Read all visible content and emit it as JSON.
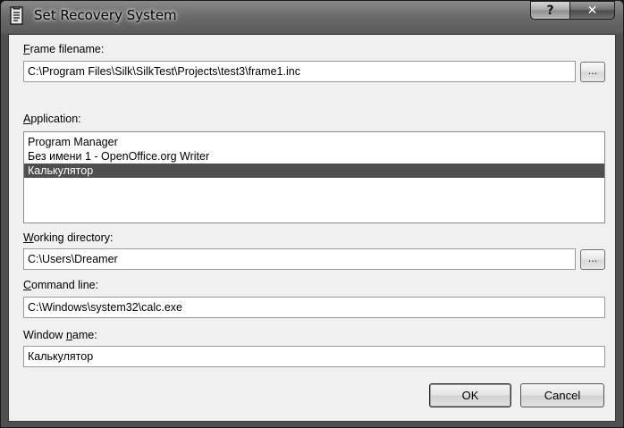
{
  "window": {
    "title": "Set Recovery System",
    "help_glyph": "?",
    "close_glyph": "✕"
  },
  "frame_filename": {
    "label_access": "F",
    "label_rest": "rame filename:",
    "value": "C:\\Program Files\\Silk\\SilkTest\\Projects\\test3\\frame1.inc",
    "browse_label": "..."
  },
  "application": {
    "label_access": "A",
    "label_rest": "pplication:",
    "items": [
      {
        "label": "Program Manager"
      },
      {
        "label": "Без имени 1 - OpenOffice.org Writer"
      },
      {
        "label": "Калькулятор"
      }
    ],
    "selected_index": 2
  },
  "working_directory": {
    "label_access": "W",
    "label_rest": "orking directory:",
    "value": "C:\\Users\\Dreamer",
    "browse_label": "..."
  },
  "command_line": {
    "label_access": "C",
    "label_rest": "ommand line:",
    "value": "C:\\Windows\\system32\\calc.exe"
  },
  "window_name": {
    "label_pre": "Window ",
    "label_access": "n",
    "label_rest": "ame:",
    "value": "Калькулятор"
  },
  "buttons": {
    "ok": "OK",
    "cancel": "Cancel"
  }
}
